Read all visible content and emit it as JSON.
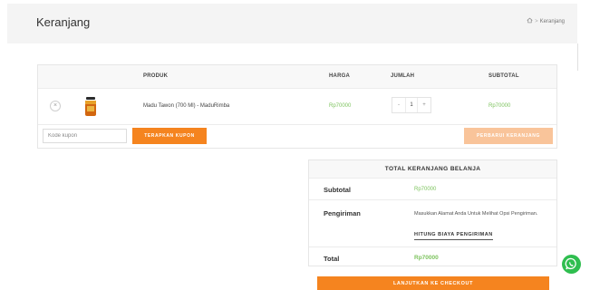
{
  "header": {
    "title": "Keranjang",
    "breadcrumb": {
      "separator": ">",
      "current": "Keranjang"
    }
  },
  "cart": {
    "columns": {
      "product": "PRODUK",
      "price": "HARGA",
      "qty": "JUMLAH",
      "subtotal": "SUBTOTAL"
    },
    "items": [
      {
        "remove": "×",
        "name": "Madu Tawon (700 Ml) - MaduRimba",
        "price": "Rp70000",
        "qty_minus": "-",
        "qty": "1",
        "qty_plus": "+",
        "subtotal": "Rp70000"
      }
    ],
    "coupon_placeholder": "Kode kupon",
    "apply_label": "TERAPKAN KUPON",
    "update_label": "PERBARUI KERANJANG"
  },
  "totals": {
    "title": "TOTAL KERANJANG BELANJA",
    "subtotal_label": "Subtotal",
    "subtotal_value": "Rp70000",
    "shipping_label": "Pengiriman",
    "shipping_text": "Masukkan Alamat Anda Untuk Melihat Opsi Pengiriman.",
    "shipping_link": "HITUNG BIAYA PENGIRIMAN",
    "total_label": "Total",
    "total_value": "Rp70000",
    "checkout_label": "LANJUTKAN KE CHECKOUT"
  },
  "colors": {
    "accent": "#f5841f",
    "price": "#7cc35d",
    "whatsapp": "#2fbe4f"
  },
  "icons": {
    "breadcrumb_home": "home-icon",
    "remove": "close-icon",
    "chat": "whatsapp-icon"
  }
}
